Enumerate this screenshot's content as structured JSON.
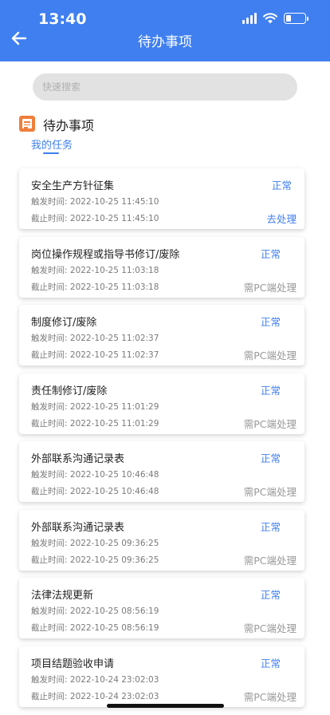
{
  "status_bar": {
    "time": "13:40"
  },
  "header": {
    "title": "待办事项"
  },
  "search": {
    "placeholder": "快速搜索"
  },
  "section": {
    "title": "待办事项",
    "tab": "我的任务"
  },
  "labels": {
    "trigger": "触发时间: ",
    "deadline": "截止时间: "
  },
  "tasks": [
    {
      "title": "安全生产方针征集",
      "status": "正常",
      "trigger": "2022-10-25 11:45:10",
      "deadline": "2022-10-25 11:45:10",
      "action": "去处理"
    },
    {
      "title": "岗位操作规程或指导书修订/废除",
      "status": "正常",
      "trigger": "2022-10-25 11:03:18",
      "deadline": "2022-10-25 11:03:18",
      "action": "需PC端处理"
    },
    {
      "title": "制度修订/废除",
      "status": "正常",
      "trigger": "2022-10-25 11:02:37",
      "deadline": "2022-10-25 11:02:37",
      "action": "需PC端处理"
    },
    {
      "title": "责任制修订/废除",
      "status": "正常",
      "trigger": "2022-10-25 11:01:29",
      "deadline": "2022-10-25 11:01:29",
      "action": "需PC端处理"
    },
    {
      "title": "外部联系沟通记录表",
      "status": "正常",
      "trigger": "2022-10-25 10:46:48",
      "deadline": "2022-10-25 10:46:48",
      "action": "需PC端处理"
    },
    {
      "title": "外部联系沟通记录表",
      "status": "正常",
      "trigger": "2022-10-25 09:36:25",
      "deadline": "2022-10-25 09:36:25",
      "action": "需PC端处理"
    },
    {
      "title": "法律法规更新",
      "status": "正常",
      "trigger": "2022-10-25 08:56:19",
      "deadline": "2022-10-25 08:56:19",
      "action": "需PC端处理"
    },
    {
      "title": "项目结题验收申请",
      "status": "正常",
      "trigger": "2022-10-24 23:02:03",
      "deadline": "2022-10-24 23:02:03",
      "action": "需PC端处理"
    }
  ],
  "colors": {
    "primary": "#3f7ff0",
    "accent": "#ef7f3c",
    "muted": "#999999"
  }
}
